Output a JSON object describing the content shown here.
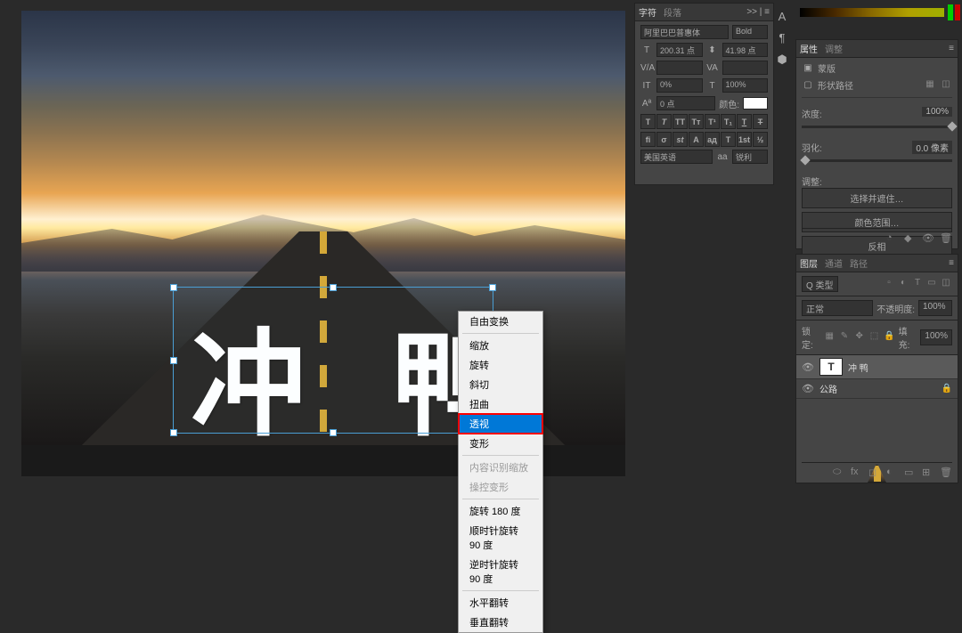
{
  "canvas": {
    "text_content": "冲 鸭"
  },
  "context_menu": {
    "items": [
      {
        "label": "自由变换",
        "enabled": true
      },
      {
        "divider": true
      },
      {
        "label": "缩放",
        "enabled": true
      },
      {
        "label": "旋转",
        "enabled": true
      },
      {
        "label": "斜切",
        "enabled": true
      },
      {
        "label": "扭曲",
        "enabled": true
      },
      {
        "label": "透视",
        "enabled": true,
        "selected": true
      },
      {
        "label": "变形",
        "enabled": true
      },
      {
        "divider": true
      },
      {
        "label": "内容识别缩放",
        "enabled": false
      },
      {
        "label": "操控变形",
        "enabled": false
      },
      {
        "divider": true
      },
      {
        "label": "旋转 180 度",
        "enabled": true
      },
      {
        "label": "顺时针旋转 90 度",
        "enabled": true
      },
      {
        "label": "逆时针旋转 90 度",
        "enabled": true
      },
      {
        "divider": true
      },
      {
        "label": "水平翻转",
        "enabled": true
      },
      {
        "label": "垂直翻转",
        "enabled": true
      }
    ]
  },
  "char_panel": {
    "tab1": "字符",
    "tab2": "段落",
    "collapse": ">> | ≡",
    "font_family": "阿里巴巴普惠体",
    "font_style": "Bold",
    "size_icon": "T",
    "size": "200.31 点",
    "leading_icon": "⬍",
    "leading": "41.98 点",
    "va_label": "V/A",
    "tracking": "VA",
    "scale_v": "IT",
    "scale_v_val": "0%",
    "scale_h_icon": "T",
    "scale_h": "100%",
    "baseline_icon": "Aª",
    "baseline": "0 点",
    "color_label": "颜色:",
    "lang": "美国英语",
    "aa_label": "aa",
    "aa_value": "锐利"
  },
  "props_panel": {
    "tab1": "属性",
    "tab2": "调整",
    "mask_icon": "▣",
    "mask_label": "蒙版",
    "shape_label": "形状路径",
    "density_label": "浓度:",
    "density_val": "100%",
    "feather_label": "羽化:",
    "feather_val": "0.0 像素",
    "refine_label": "调整:",
    "btn_select": "选择并遮住…",
    "btn_color_range": "颜色范围…",
    "btn_invert": "反相"
  },
  "layers_panel": {
    "tab1": "图层",
    "tab2": "通道",
    "tab3": "路径",
    "kind_label": "Q 类型",
    "blend_mode": "正常",
    "opacity_label": "不透明度:",
    "opacity_val": "100%",
    "lock_label": "锁定:",
    "fill_label": "填充:",
    "fill_val": "100%",
    "layers": [
      {
        "name": "冲 鸭",
        "type": "text",
        "visible": true,
        "selected": true
      },
      {
        "name": "公路",
        "type": "image",
        "visible": true,
        "locked": true
      }
    ]
  }
}
